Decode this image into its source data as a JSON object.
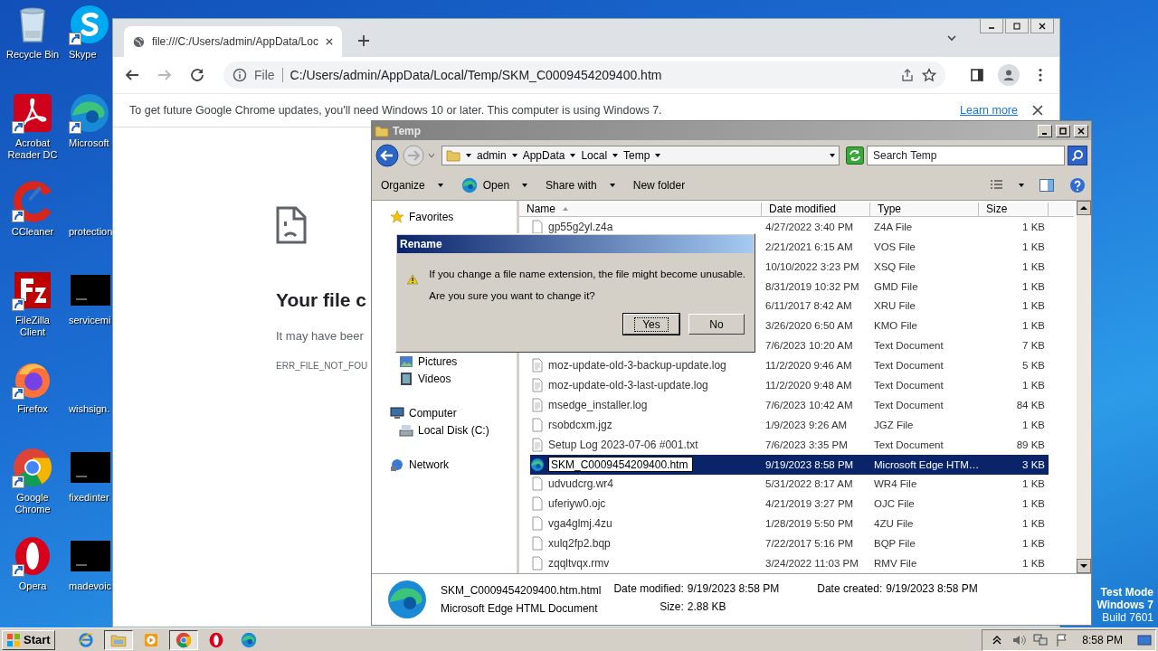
{
  "desktop": {
    "icons": [
      {
        "label": "Recycle Bin",
        "kind": "recycle",
        "shortcut": false
      },
      {
        "label": "Skype",
        "kind": "skype",
        "shortcut": true
      },
      {
        "label": "Acrobat Reader DC",
        "kind": "acrobat",
        "shortcut": true
      },
      {
        "label": "Microsoft",
        "kind": "edge",
        "shortcut": true
      },
      {
        "label": "CCleaner",
        "kind": "ccleaner",
        "shortcut": true
      },
      {
        "label": "protection",
        "kind": "blank",
        "shortcut": false
      },
      {
        "label": "FileZilla Client",
        "kind": "filezilla",
        "shortcut": true
      },
      {
        "label": "servicemi",
        "kind": "console",
        "shortcut": false
      },
      {
        "label": "Firefox",
        "kind": "firefox",
        "shortcut": true
      },
      {
        "label": "wishsign.",
        "kind": "blank",
        "shortcut": false
      },
      {
        "label": "Google Chrome",
        "kind": "chrome",
        "shortcut": true
      },
      {
        "label": "fixedinter",
        "kind": "console",
        "shortcut": false
      },
      {
        "label": "Opera",
        "kind": "opera",
        "shortcut": true
      },
      {
        "label": "madevoic",
        "kind": "console",
        "shortcut": false
      }
    ],
    "watermark": [
      "Test Mode",
      "Windows 7",
      "Build 7601"
    ]
  },
  "browser": {
    "tab_title": "file:///C:/Users/admin/AppData/Loc",
    "forward_disabled": true,
    "address": {
      "scheme": "File",
      "url": "C:/Users/admin/AppData/Local/Temp/SKM_C0009454209400.htm"
    },
    "infobar": {
      "text": "To get future Google Chrome updates, you'll need Windows 10 or later. This computer is using Windows 7.",
      "link": "Learn more"
    },
    "error": {
      "heading": "Your file c",
      "body": "It may have beer",
      "code": "ERR_FILE_NOT_FOU"
    }
  },
  "explorer": {
    "title": "Temp",
    "breadcrumb": [
      "admin",
      "AppData",
      "Local",
      "Temp"
    ],
    "search": {
      "placeholder": "Search Temp"
    },
    "toolbar": [
      {
        "label": "Organize",
        "kind": "plain",
        "dropdown": true
      },
      {
        "label": "Open",
        "kind": "app",
        "dropdown": true
      },
      {
        "label": "Share with",
        "kind": "plain",
        "dropdown": true
      },
      {
        "label": "New folder",
        "kind": "plain",
        "dropdown": false
      }
    ],
    "nav": [
      {
        "label": "Favorites",
        "kind": "favorites"
      },
      {
        "children": [
          {
            "label": "Pictures",
            "kind": "pictures"
          },
          {
            "label": "Videos",
            "kind": "videos"
          }
        ]
      },
      {
        "label": "Computer",
        "kind": "computer",
        "children": [
          {
            "label": "Local Disk (C:)",
            "kind": "disk"
          }
        ]
      },
      {
        "label": "Network",
        "kind": "network"
      }
    ],
    "columns": [
      {
        "label": "Name",
        "sorted": true
      },
      {
        "label": "Date modified",
        "sorted": false
      },
      {
        "label": "Type",
        "sorted": false
      },
      {
        "label": "Size",
        "sorted": false
      }
    ],
    "rows": [
      {
        "kind": "file",
        "name": "gp55g2yl.z4a",
        "date": "4/27/2022 3:40 PM",
        "type": "Z4A File",
        "size": "1 KB",
        "selected": false,
        "editing": false
      },
      {
        "date": "2/21/2021 6:15 AM",
        "type": "VOS File",
        "size": "1 KB",
        "selected": false
      },
      {
        "date": "10/10/2022 3:23 PM",
        "type": "XSQ File",
        "size": "1 KB",
        "selected": false
      },
      {
        "date": "8/31/2019 10:32 PM",
        "type": "GMD File",
        "size": "1 KB",
        "selected": false
      },
      {
        "date": "6/11/2017 8:42 AM",
        "type": "XRU File",
        "size": "1 KB",
        "selected": false
      },
      {
        "date": "3/26/2020 6:50 AM",
        "type": "KMO File",
        "size": "1 KB",
        "selected": false
      },
      {
        "date": "7/6/2023 10:20 AM",
        "type": "Text Document",
        "size": "7 KB",
        "selected": false
      },
      {
        "kind": "text",
        "name": "moz-update-old-3-backup-update.log",
        "date": "11/2/2020 9:46 AM",
        "type": "Text Document",
        "size": "5 KB",
        "selected": false,
        "editing": false
      },
      {
        "kind": "text",
        "name": "moz-update-old-3-last-update.log",
        "date": "11/2/2020 9:48 AM",
        "type": "Text Document",
        "size": "1 KB",
        "selected": false,
        "editing": false
      },
      {
        "kind": "text",
        "name": "msedge_installer.log",
        "date": "7/6/2023 10:42 AM",
        "type": "Text Document",
        "size": "84 KB",
        "selected": false,
        "editing": false
      },
      {
        "kind": "file",
        "name": "rsobdcxm.jgz",
        "date": "1/9/2023 9:26 AM",
        "type": "JGZ File",
        "size": "1 KB",
        "selected": false,
        "editing": false
      },
      {
        "kind": "text",
        "name": "Setup Log 2023-07-06 #001.txt",
        "date": "7/6/2023 3:35 PM",
        "type": "Text Document",
        "size": "89 KB",
        "selected": false,
        "editing": false
      },
      {
        "kind": "edge",
        "name": "SKM_C0009454209400.htm",
        "date": "9/19/2023 8:58 PM",
        "type": "Microsoft Edge HTM…",
        "size": "3 KB",
        "selected": true,
        "editing": true
      },
      {
        "kind": "file",
        "name": "udvudcrg.wr4",
        "date": "5/31/2022 8:17 AM",
        "type": "WR4 File",
        "size": "1 KB",
        "selected": false,
        "editing": false
      },
      {
        "kind": "file",
        "name": "uferiyw0.ojc",
        "date": "4/21/2019 3:27 PM",
        "type": "OJC File",
        "size": "1 KB",
        "selected": false,
        "editing": false
      },
      {
        "kind": "file",
        "name": "vga4glmj.4zu",
        "date": "1/28/2019 5:50 PM",
        "type": "4ZU File",
        "size": "1 KB",
        "selected": false,
        "editing": false
      },
      {
        "kind": "file",
        "name": "xulq2fp2.bqp",
        "date": "7/22/2017 5:16 PM",
        "type": "BQP File",
        "size": "1 KB",
        "selected": false,
        "editing": false
      },
      {
        "kind": "file",
        "name": "zqqltvqx.rmv",
        "date": "3/24/2022 11:03 PM",
        "type": "RMV File",
        "size": "1 KB",
        "selected": false,
        "editing": false
      }
    ],
    "details": {
      "name": "SKM_C0009454209400.htm.html",
      "type": "Microsoft Edge HTML Document",
      "fields": [
        {
          "label": "Date modified:",
          "value": "9/19/2023 8:58 PM"
        },
        {
          "label": "Size:",
          "value": "2.88 KB"
        },
        {
          "label": "Date created:",
          "value": "9/19/2023 8:58 PM"
        }
      ]
    }
  },
  "dialog": {
    "title": "Rename",
    "messages": [
      "If you change a file name extension, the file might become unusable.",
      "Are you sure you want to change it?"
    ],
    "buttons": [
      {
        "label": "Yes",
        "default": true
      },
      {
        "label": "No",
        "default": false
      }
    ]
  },
  "taskbar": {
    "start": "Start",
    "apps": [
      {
        "kind": "ie",
        "pressed": false
      },
      {
        "kind": "folder",
        "pressed": true
      },
      {
        "kind": "media",
        "pressed": false
      },
      {
        "kind": "chrome",
        "pressed": true
      },
      {
        "kind": "opera",
        "pressed": false
      },
      {
        "kind": "edge",
        "pressed": false
      }
    ],
    "clock": "8:58 PM"
  }
}
